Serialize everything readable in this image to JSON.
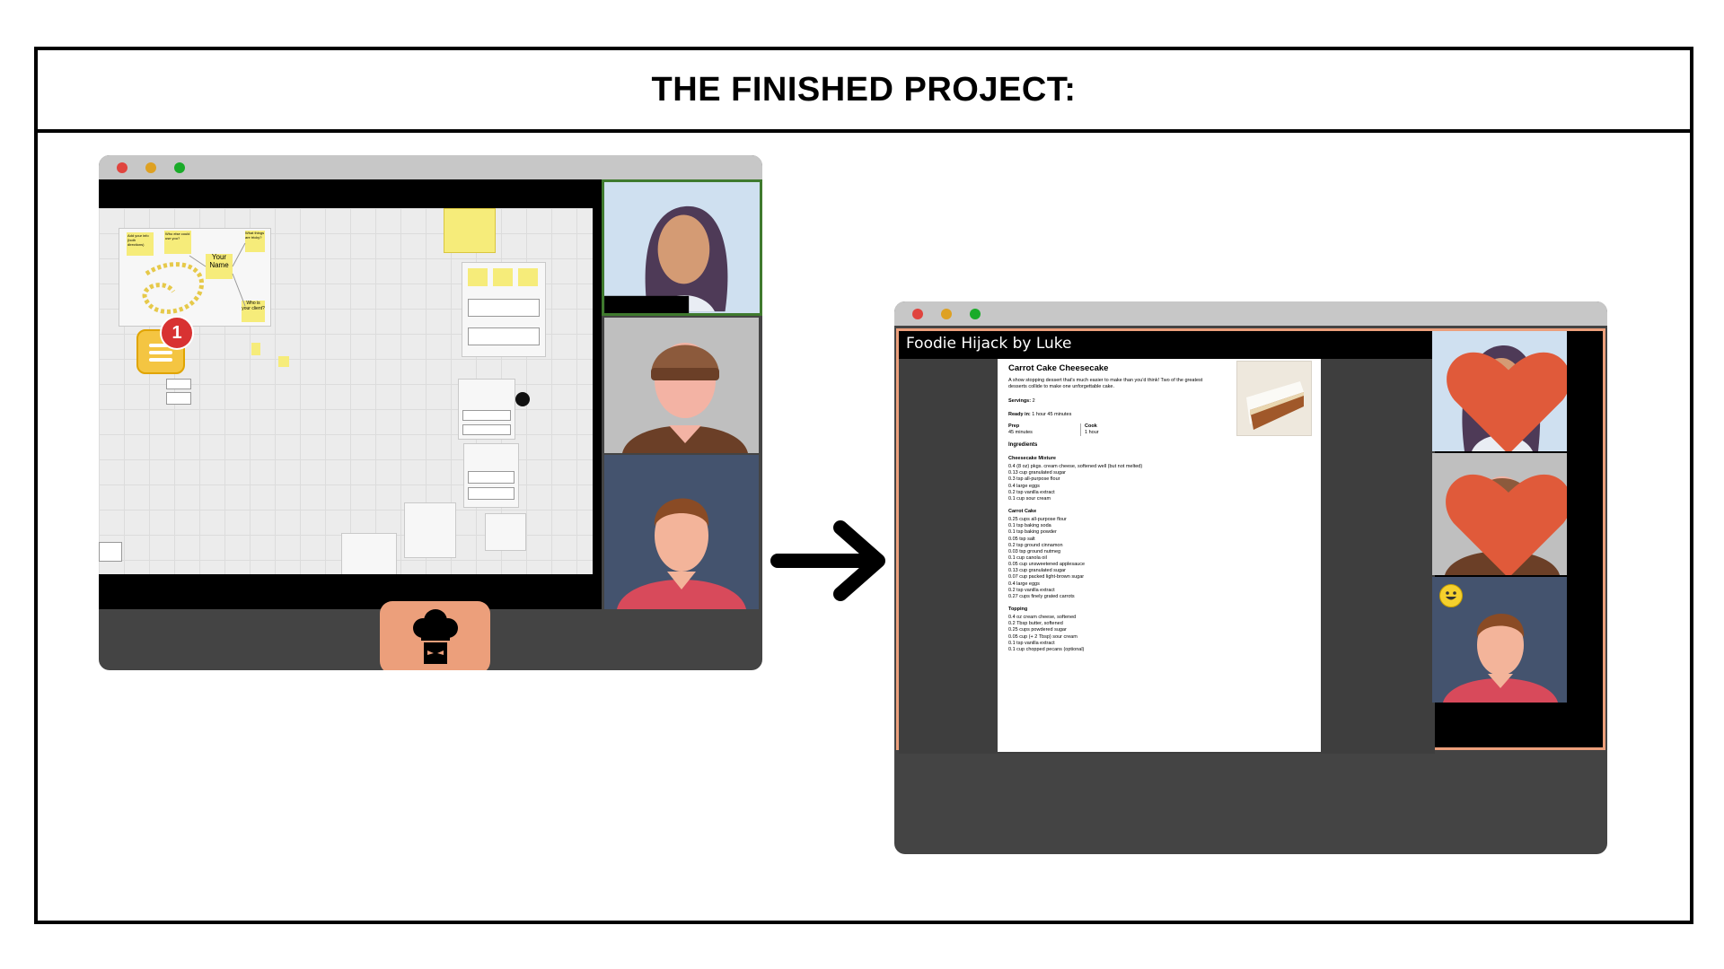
{
  "heading": "THE FINISHED PROJECT:",
  "colors": {
    "chef_button": "#ec9f7b",
    "app_border": "#ec9f7b",
    "heart": "#e05a3a",
    "active_speaker_border": "#3f7a2e"
  },
  "left_window": {
    "stickies": {
      "a": "Add your info (both directions)",
      "b": "Who else could use you?",
      "c": "Your Name",
      "d": "What things are tricky?",
      "e": "Who is your client?"
    },
    "badge_count": "1",
    "chef_button_icon": "chef-hat-icon"
  },
  "right_window": {
    "app_title": "Foodie Hijack by Luke",
    "reactions": [
      "heart-icon",
      "heart-icon",
      "smiley-icon"
    ],
    "recipe": {
      "title": "Carrot Cake Cheesecake",
      "description": "A show stopping dessert that's much easier to make than you'd think! Two of the greatest desserts collide to make one unforgettable cake.",
      "servings_label": "Servings:",
      "servings_value": "2",
      "ready_label": "Ready in:",
      "ready_value": "1 hour 45 minutes",
      "prep_label": "Prep",
      "prep_value": "45 minutes",
      "cook_label": "Cook",
      "cook_value": "1 hour",
      "ingredients_heading": "Ingredients",
      "sections": [
        {
          "name": "Cheesecake Mixture",
          "items": [
            "0.4 (8 oz) pkgs. cream cheese, softened well (but not melted)",
            "0.13 cup granulated sugar",
            "0.3 tsp all-purpose flour",
            "0.4 large eggs",
            "0.2 tsp vanilla extract",
            "0.1 cup sour cream"
          ]
        },
        {
          "name": "Carrot Cake",
          "items": [
            "0.25 cups all-purpose flour",
            "0.1 tsp baking soda",
            "0.1 tsp baking powder",
            "0.05 tsp salt",
            "0.2 tsp ground cinnamon",
            "0.03 tsp ground nutmeg",
            "0.1 cup canola oil",
            "0.05 cup unsweetened applesauce",
            "0.13 cup granulated sugar",
            "0.07 cup packed light-brown sugar",
            "0.4 large eggs",
            "0.2 tsp vanilla extract",
            "0.27 cups finely grated carrots"
          ]
        },
        {
          "name": "Topping",
          "items": [
            "0.4 oz cream cheese, softened",
            "0.2 Tbsp butter, softened",
            "0.25 cups powdered sugar",
            "0.05 cup (+ 2 Tbsp) sour cream",
            "0.1 tsp vanilla extract",
            "0.1 cup chopped pecans (optional)"
          ]
        }
      ]
    }
  }
}
